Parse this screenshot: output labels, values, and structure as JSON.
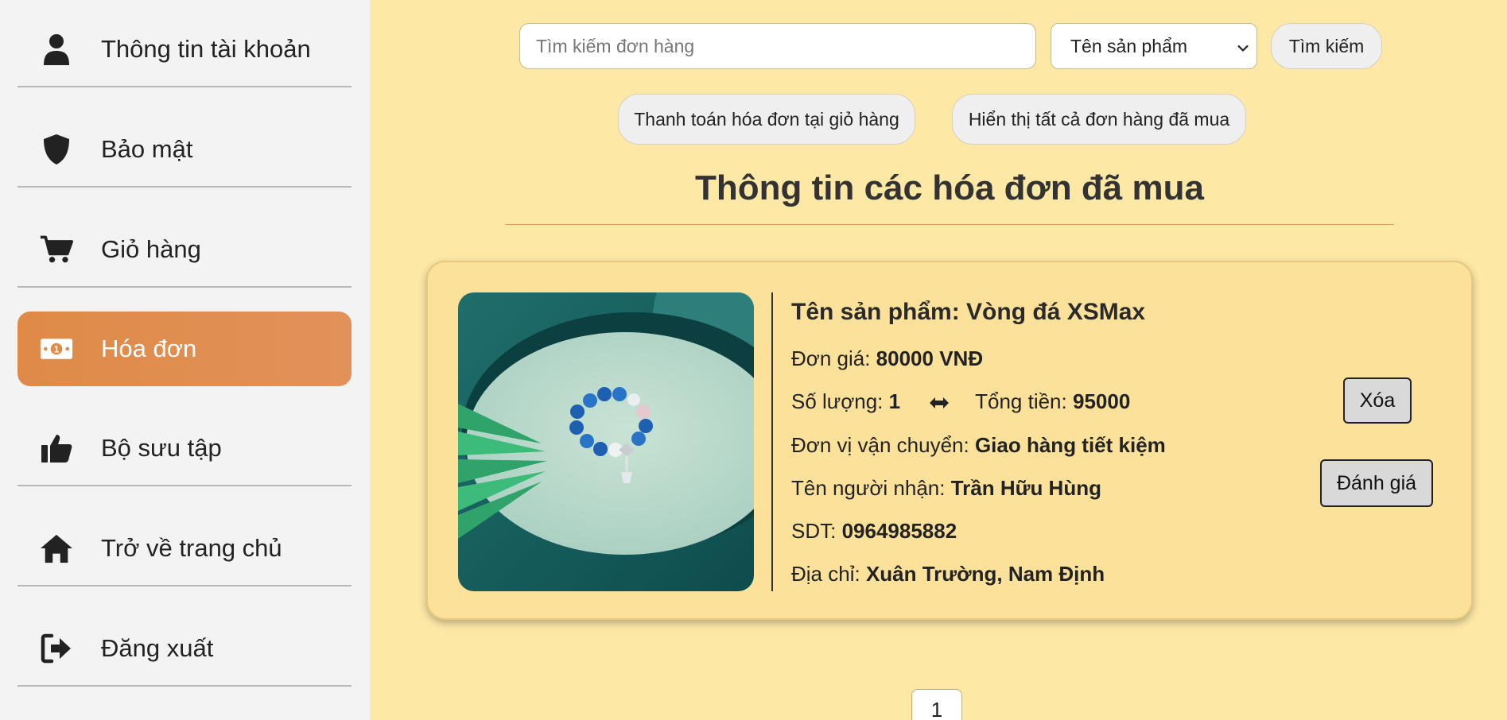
{
  "sidebar": {
    "items": [
      {
        "label": "Thông tin tài khoản",
        "icon": "user-icon"
      },
      {
        "label": "Bảo mật",
        "icon": "shield-icon"
      },
      {
        "label": "Giỏ hàng",
        "icon": "cart-icon"
      },
      {
        "label": "Hóa đơn",
        "icon": "money-bill-icon",
        "active": true
      },
      {
        "label": "Bộ sưu tập",
        "icon": "thumbs-up-icon"
      },
      {
        "label": "Trở về trang chủ",
        "icon": "home-icon"
      },
      {
        "label": "Đăng xuất",
        "icon": "logout-icon"
      }
    ],
    "active_color": "#df8a47",
    "background": "#f3f3f3"
  },
  "search": {
    "placeholder": "Tìm kiếm đơn hàng",
    "filter_selected": "Tên sản phẩm",
    "button_label": "Tìm kiếm"
  },
  "actions": {
    "pay_label": "Thanh toán hóa đơn tại giỏ hàng",
    "show_all_label": "Hiển thị tất cả đơn hàng đã mua"
  },
  "page": {
    "title": "Thông tin các hóa đơn đã mua",
    "background": "#fde8a6"
  },
  "order": {
    "name_label": "Tên sản phẩm:",
    "name": "Vòng đá XSMax",
    "price_label": "Đơn giá:",
    "price": "80000 VNĐ",
    "qty_label": "Số lượng:",
    "qty": "1",
    "total_label": "Tổng tiền:",
    "total": "95000",
    "shipping_label": "Đơn vị vận chuyển:",
    "shipping": "Giao hàng tiết kiệm",
    "receiver_label": "Tên người nhận:",
    "receiver": "Trần Hữu Hùng",
    "phone_label": "SDT:",
    "phone": "0964985882",
    "address_label": "Địa chỉ:",
    "address": "Xuân Trường, Nam Định",
    "delete_label": "Xóa",
    "review_label": "Đánh giá"
  },
  "pagination": {
    "current_page": "1"
  }
}
